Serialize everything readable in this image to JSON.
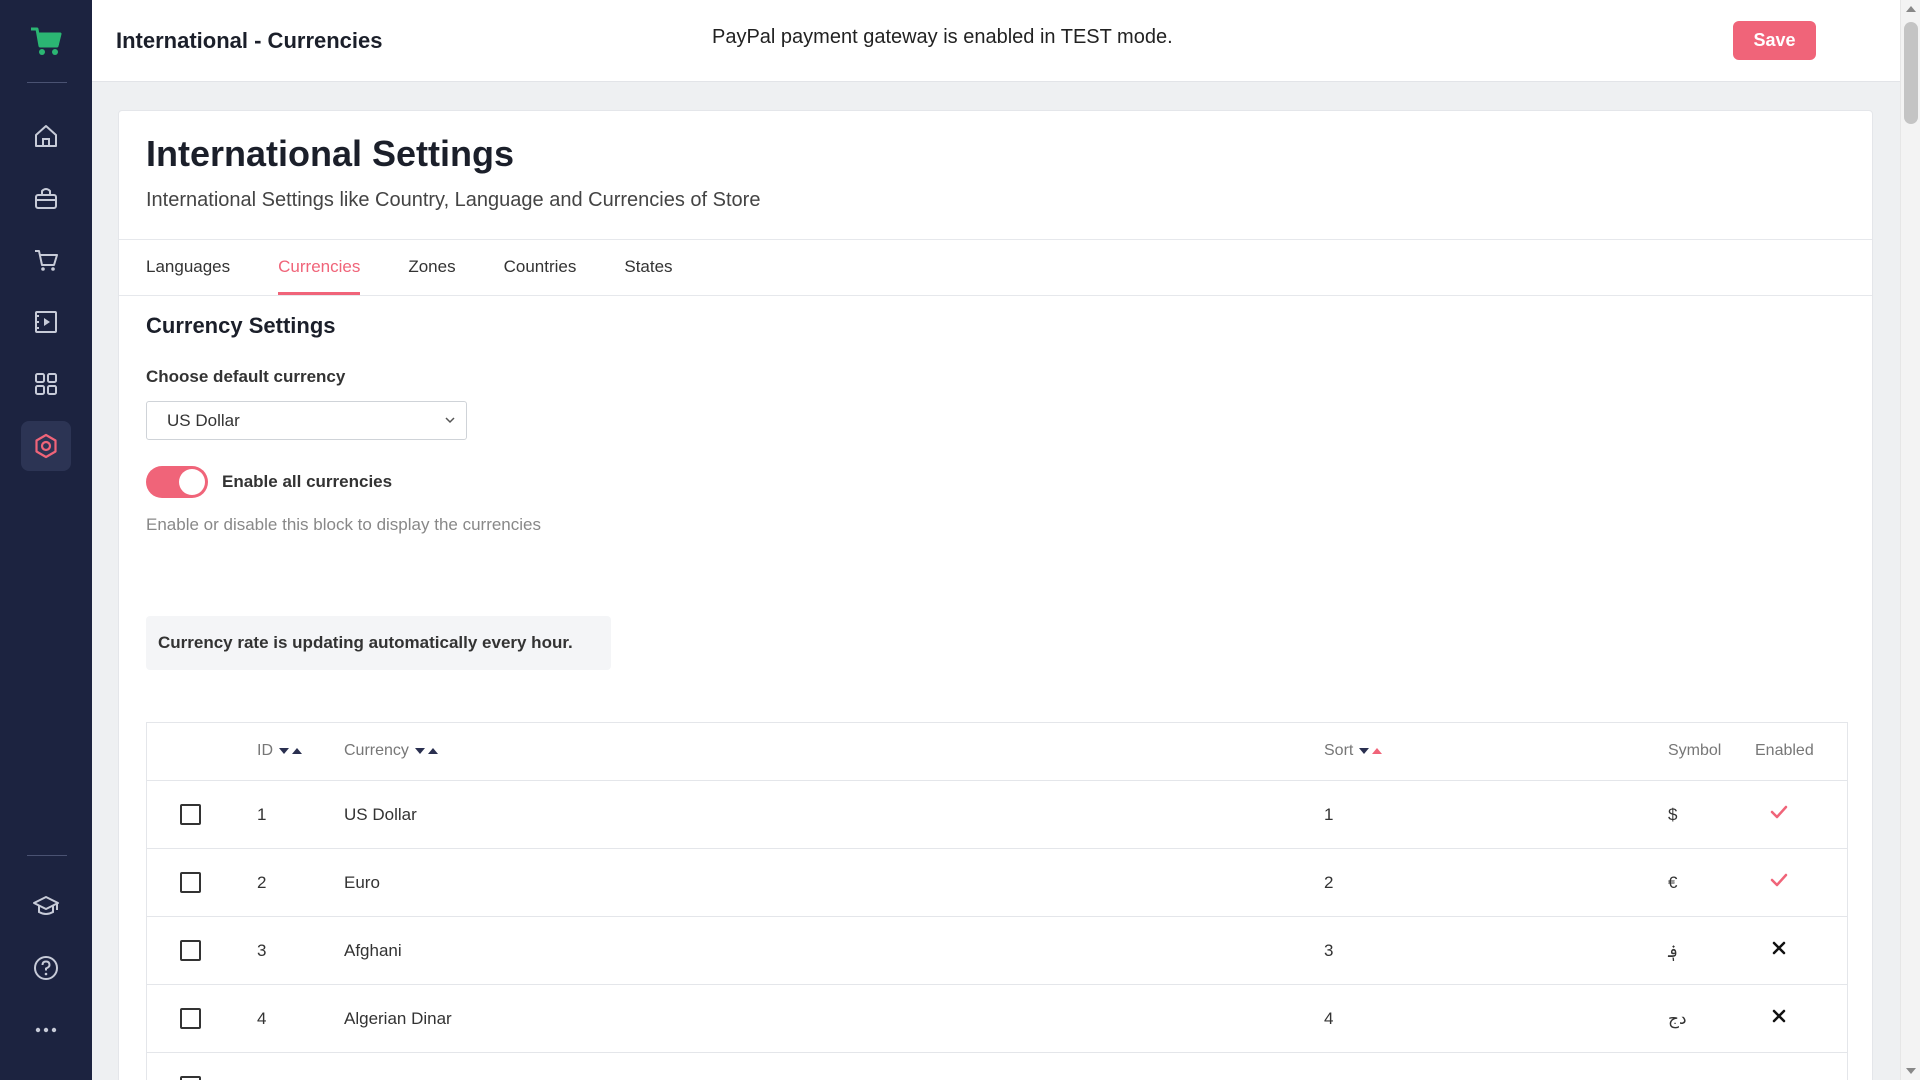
{
  "topbar": {
    "title": "International - Currencies",
    "notice": "PayPal payment gateway is enabled in TEST mode.",
    "save_label": "Save"
  },
  "sidebar": {
    "logo": "cart-logo-icon",
    "items": [
      {
        "icon": "home-icon"
      },
      {
        "icon": "bag-icon"
      },
      {
        "icon": "cart-icon"
      },
      {
        "icon": "media-icon"
      },
      {
        "icon": "apps-grid-icon"
      },
      {
        "icon": "settings-icon",
        "active": true
      },
      {
        "icon": "graduation-cap-icon"
      },
      {
        "icon": "help-icon"
      },
      {
        "icon": "more-icon"
      }
    ]
  },
  "card": {
    "title": "International Settings",
    "subtitle": "International Settings like Country, Language and Currencies of Store"
  },
  "tabs": [
    {
      "label": "Languages",
      "active": false
    },
    {
      "label": "Currencies",
      "active": true
    },
    {
      "label": "Zones",
      "active": false
    },
    {
      "label": "Countries",
      "active": false
    },
    {
      "label": "States",
      "active": false
    }
  ],
  "currency_settings": {
    "section_title": "Currency Settings",
    "default_label": "Choose default currency",
    "default_value": "US Dollar",
    "enable_all_label": "Enable all currencies",
    "enable_all_on": true,
    "help_text": "Enable or disable this block to display the currencies",
    "info": "Currency rate is updating automatically every hour."
  },
  "table": {
    "headers": {
      "id": "ID",
      "currency": "Currency",
      "sort": "Sort",
      "symbol": "Symbol",
      "enabled": "Enabled"
    },
    "rows": [
      {
        "id": "1",
        "currency": "US Dollar",
        "sort": "1",
        "symbol": "$",
        "enabled": true
      },
      {
        "id": "2",
        "currency": "Euro",
        "sort": "2",
        "symbol": "€",
        "enabled": true
      },
      {
        "id": "3",
        "currency": "Afghani",
        "sort": "3",
        "symbol": "؋",
        "enabled": false
      },
      {
        "id": "4",
        "currency": "Algerian Dinar",
        "sort": "4",
        "symbol": "دج",
        "enabled": false
      }
    ]
  },
  "colors": {
    "accent": "#f06479",
    "sidebar_bg": "#1c2340",
    "logo_green": "#2bb673"
  }
}
